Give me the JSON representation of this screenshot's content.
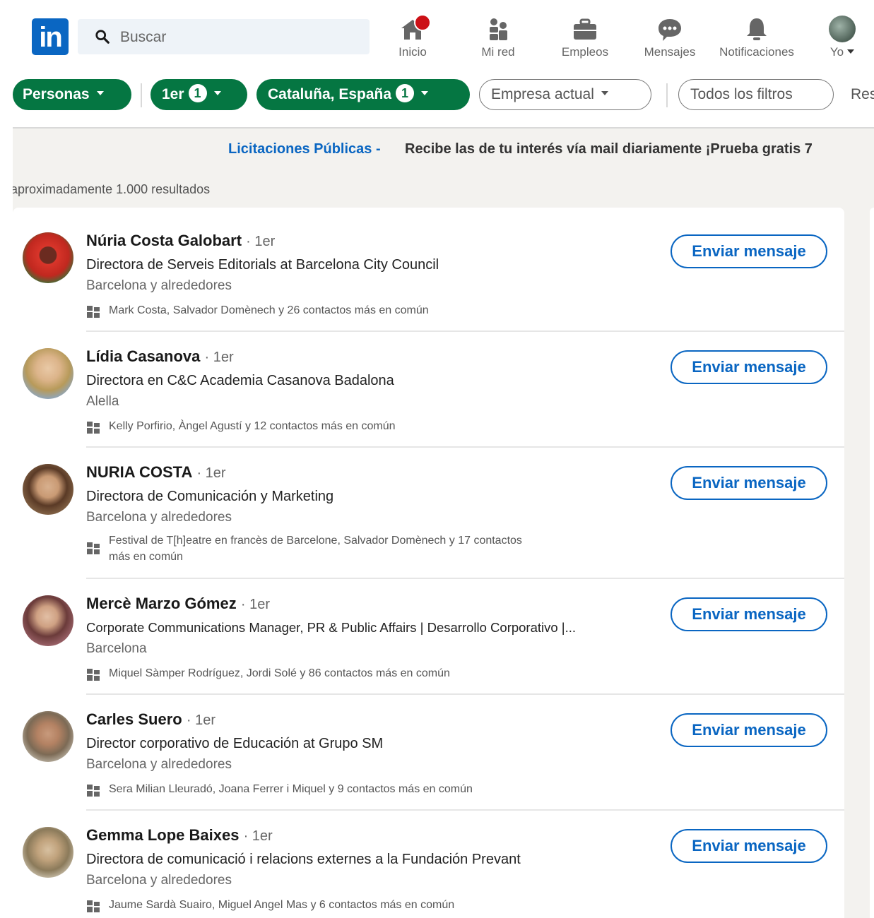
{
  "nav": {
    "logo": "in",
    "search_placeholder": "Buscar",
    "items": [
      {
        "label": "Inicio",
        "icon": "home-icon",
        "has_badge": true
      },
      {
        "label": "Mi red",
        "icon": "network-icon"
      },
      {
        "label": "Empleos",
        "icon": "briefcase-icon"
      },
      {
        "label": "Mensajes",
        "icon": "messaging-icon"
      },
      {
        "label": "Notificaciones",
        "icon": "bell-icon"
      },
      {
        "label": "Yo",
        "icon": "avatar"
      }
    ]
  },
  "filters": {
    "personas": "Personas",
    "first_degree": "1er",
    "first_degree_count": "1",
    "location": "Cataluña, España",
    "location_count": "1",
    "current_company": "Empresa actual",
    "all_filters": "Todos los filtros",
    "reset": "Res"
  },
  "promo": {
    "link": "Licitaciones Públicas -",
    "text": "Recibe las de tu interés vía mail diariamente ¡Prueba gratis 7"
  },
  "results_count": "aproximadamente 1.000 resultados",
  "colors": {
    "brand": "#0a66c2",
    "filter_green": "#057642",
    "badge_red": "#cc1016"
  },
  "results": [
    {
      "name": "Núria Costa Galobart",
      "degree": "· 1er",
      "headline": "Directora de Serveis Editorials at Barcelona City Council",
      "location": "Barcelona y alrededores",
      "shared": "Mark Costa, Salvador Domènech y 26 contactos más en común",
      "button": "Enviar mensaje"
    },
    {
      "name": "Lídia Casanova",
      "degree": "· 1er",
      "headline": "Directora en C&C Academia Casanova Badalona",
      "location": "Alella",
      "shared": "Kelly Porfirio, Àngel Agustí y 12 contactos más en común",
      "button": "Enviar mensaje"
    },
    {
      "name": "NURIA COSTA",
      "degree": "· 1er",
      "headline": "Directora de Comunicación y Marketing",
      "location": "Barcelona y alrededores",
      "shared": "Festival de T[h]eatre en francès de Barcelone, Salvador Domènech y 17 contactos más en común",
      "button": "Enviar mensaje"
    },
    {
      "name": "Mercè Marzo Gómez",
      "degree": "· 1er",
      "headline": "Corporate Communications Manager, PR & Public Affairs | Desarrollo Corporativo |...",
      "location": "Barcelona",
      "shared": "Miquel Sàmper Rodríguez, Jordi Solé y 86 contactos más en común",
      "button": "Enviar mensaje"
    },
    {
      "name": "Carles Suero",
      "degree": "· 1er",
      "headline": "Director corporativo de Educación at Grupo SM",
      "location": "Barcelona y alrededores",
      "shared": "Sera Milian Lleuradó, Joana Ferrer i Miquel y 9 contactos más en común",
      "button": "Enviar mensaje"
    },
    {
      "name": "Gemma Lope Baixes",
      "degree": "· 1er",
      "headline": "Directora de comunicació i relacions externes a la Fundación Prevant",
      "location": "Barcelona y alrededores",
      "shared": "Jaume Sardà Suairo, Miguel Angel Mas y 6 contactos más en común",
      "button": "Enviar mensaje"
    }
  ]
}
